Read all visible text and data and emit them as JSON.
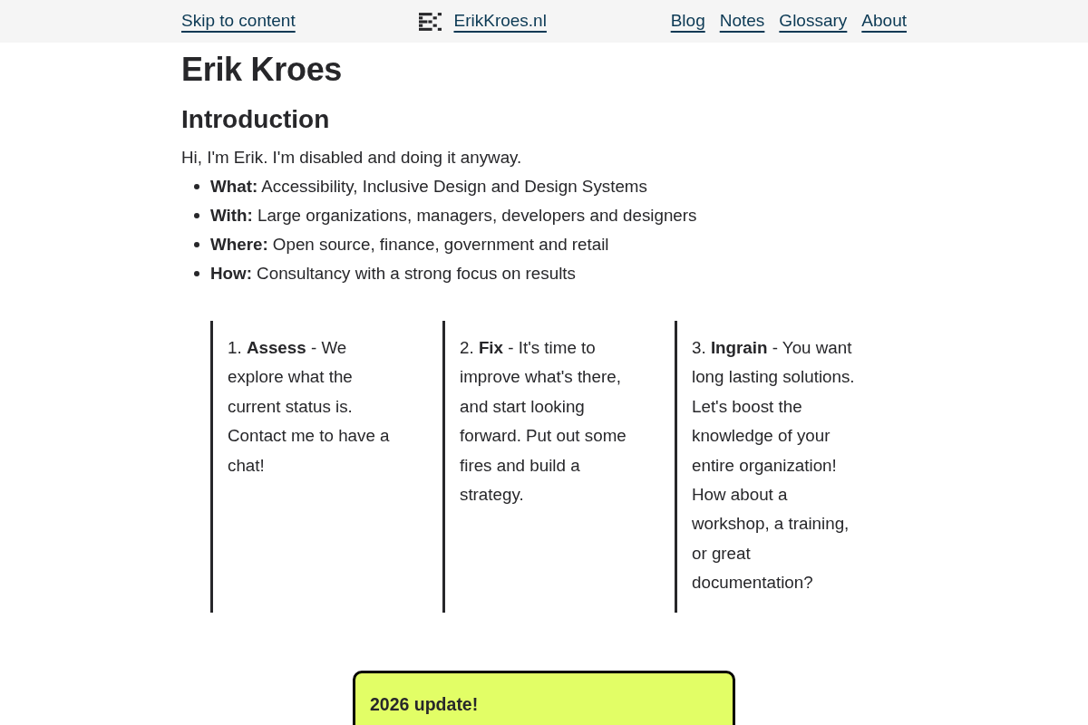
{
  "header": {
    "skip_link": "Skip to content",
    "site_name": "ErikKroes.nl",
    "nav": [
      {
        "label": "Blog"
      },
      {
        "label": "Notes"
      },
      {
        "label": "Glossary"
      },
      {
        "label": "About"
      }
    ]
  },
  "title": "Erik Kroes",
  "introduction": {
    "heading": "Introduction",
    "text": "Hi, I'm Erik. I'm disabled and doing it anyway.",
    "items": [
      "**What:** Accessibility, Inclusive Design and Design Systems",
      "**With:** Large organizations, managers, developers and designers",
      "**Where:** Open source, finance, government and retail",
      "**How:** Consultancy with a strong focus on results"
    ]
  },
  "steps": [
    "1. **Assess** - We explore what the current status is. Contact me to have a chat!",
    "2. **Fix** - It's time to improve what's there, and start looking forward. Put out some fires and build a strategy.",
    "3. **Ingrain** - You want long lasting solutions. Let's boost the knowledge of your entire organization! How about a workshop, a training, or great documentation?"
  ],
  "update": {
    "title": "2026 update!"
  }
}
